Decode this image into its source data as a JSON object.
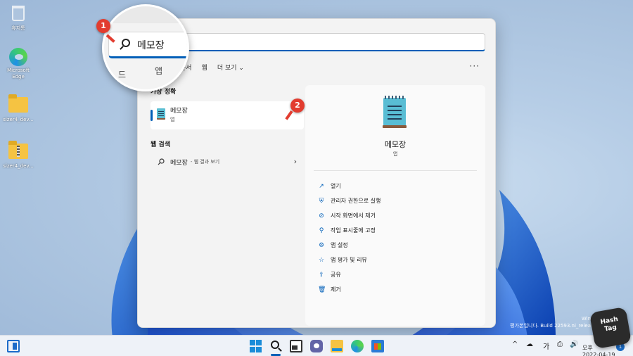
{
  "desktop": {
    "icons": [
      {
        "label": "휴지통",
        "icon": "recycle-bin-icon"
      },
      {
        "label": "Microsoft Edge",
        "icon": "edge-icon"
      },
      {
        "label": "sizer4_dev...",
        "icon": "folder-icon"
      },
      {
        "label": "sizer4_dev...",
        "icon": "zip-folder-icon"
      }
    ],
    "watermark_line1": "Win",
    "watermark_line2": "평가본입니다. Build 22593.ni_relea"
  },
  "search": {
    "query": "메모장",
    "tabs": [
      "문서",
      "웹",
      "더 보기 ⌄"
    ],
    "more": "···"
  },
  "magnifier": {
    "badge": "1",
    "query": "메모장",
    "fragment_left": "드",
    "fragment_right": "앱"
  },
  "results": {
    "best_match_title": "가장 정확",
    "best_match": {
      "name": "메모장",
      "type": "앱",
      "badge": "2"
    },
    "web_title": "웹 검색",
    "web_result": {
      "query": "메모장",
      "suffix": "- 웹 결과 보기",
      "chevron": "›"
    }
  },
  "detail": {
    "app_name": "메모장",
    "app_type": "앱",
    "actions": [
      {
        "label": "열기",
        "icon": "open-external-icon",
        "glyph": "↗"
      },
      {
        "label": "관리자 권한으로 실행",
        "icon": "admin-shield-icon",
        "glyph": "⛨"
      },
      {
        "label": "시작 화면에서 제거",
        "icon": "unpin-icon",
        "glyph": "⊘"
      },
      {
        "label": "작업 표시줄에 고정",
        "icon": "pin-icon",
        "glyph": "⚲"
      },
      {
        "label": "앱 설정",
        "icon": "gear-icon",
        "glyph": "⚙"
      },
      {
        "label": "앱 평가 및 리뷰",
        "icon": "star-icon",
        "glyph": "☆"
      },
      {
        "label": "공유",
        "icon": "share-icon",
        "glyph": "⇪"
      },
      {
        "label": "제거",
        "icon": "trash-icon",
        "glyph": "🗑"
      }
    ]
  },
  "taskbar": {
    "tray": [
      "^",
      "☁",
      "가",
      "⎙",
      "🔊"
    ],
    "clock_time": "오후",
    "clock_date": "2022-04-19",
    "notification_count": "1"
  },
  "logo": {
    "line1": "Hash",
    "line2": "Tag"
  },
  "colors": {
    "accent": "#005fb8",
    "callout": "#e23c2f"
  }
}
